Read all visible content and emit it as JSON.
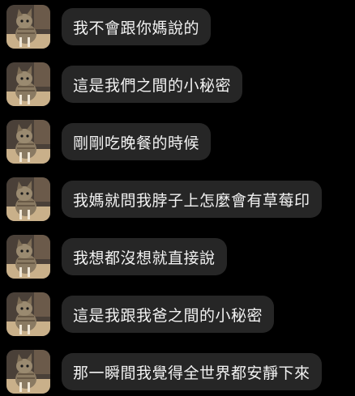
{
  "conversation": {
    "avatar_icon": "cat-avatar-icon",
    "messages": [
      {
        "text": "我不會跟你媽說的"
      },
      {
        "text": "這是我們之間的小秘密"
      },
      {
        "text": "剛剛吃晚餐的時候"
      },
      {
        "text": "我媽就問我脖子上怎麼會有草莓印"
      },
      {
        "text": "我想都沒想就直接說"
      },
      {
        "text": "這是我跟我爸之間的小秘密"
      },
      {
        "text": "那一瞬間我覺得全世界都安靜下來"
      }
    ]
  },
  "colors": {
    "background": "#000000",
    "bubble": "#262626",
    "text": "#f2f2f2"
  }
}
